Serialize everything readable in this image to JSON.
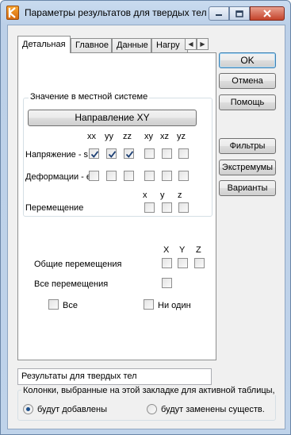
{
  "window": {
    "title": "Параметры результатов для твердых тел"
  },
  "tabs": [
    {
      "label": "Детальная"
    },
    {
      "label": "Главное"
    },
    {
      "label": "Данные"
    },
    {
      "label": "Нагру"
    }
  ],
  "local_group": {
    "caption": "Значение в местной системе",
    "direction_button": "Направление XY",
    "columns": [
      "xx",
      "yy",
      "zz",
      "xy",
      "xz",
      "yz"
    ],
    "stress_label": "Напряжение - s",
    "stress_checked": [
      true,
      true,
      true,
      false,
      false,
      false
    ],
    "strain_label": "Деформации - e",
    "strain_checked": [
      false,
      false,
      false,
      false,
      false,
      false
    ],
    "disp_columns": [
      "x",
      "y",
      "z"
    ],
    "disp_label": "Перемещение",
    "disp_checked": [
      false,
      false,
      false
    ]
  },
  "global": {
    "columns": [
      "X",
      "Y",
      "Z"
    ],
    "total_disp_label": "Общие перемещения",
    "total_disp_checked": [
      false,
      false,
      false
    ],
    "all_disp_label": "Все перемещения",
    "all_disp_checked": false
  },
  "select": {
    "all_label": "Все",
    "none_label": "Ни один"
  },
  "buttons": {
    "ok": "OK",
    "cancel": "Отмена",
    "help": "Помощь",
    "filters": "Фильтры",
    "extremes": "Экстремумы",
    "variants": "Варианты"
  },
  "table_name": "Результаты для твердых тел",
  "columns_group": {
    "caption": "Колонки, выбранные на этой закладке для активной таблицы,",
    "option_add": "будут добавлены",
    "option_replace": "будут заменены существ.",
    "selected": "add"
  }
}
